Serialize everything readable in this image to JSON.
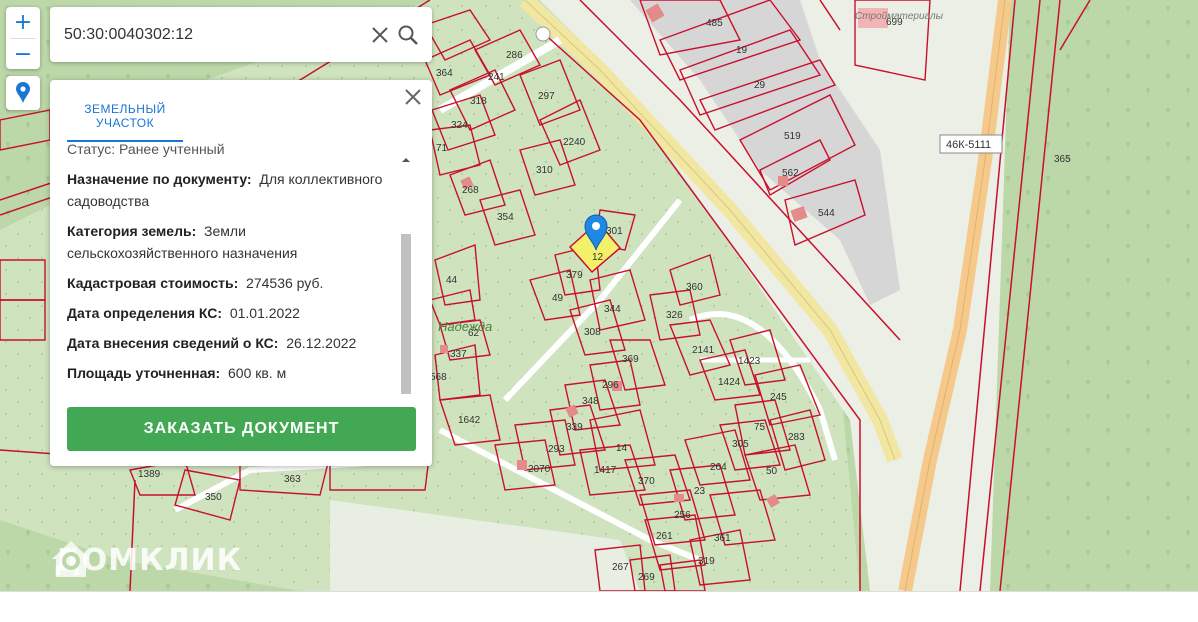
{
  "search": {
    "value": "50:30:0040302:12"
  },
  "zoom": {
    "in_label": "+",
    "out_label": "−"
  },
  "panel": {
    "tab_label_line1": "ЗЕМЕЛЬНЫЙ",
    "tab_label_line2": "УЧАСТОК",
    "status_partial": "Статус: Ранее учтенный",
    "fields": [
      {
        "label": "Назначение по документу:",
        "value": "Для коллективного садоводства"
      },
      {
        "label": "Категория земель:",
        "value": "Земли сельскохозяйственного назначения"
      },
      {
        "label": "Кадастровая стоимость:",
        "value": "274536 руб."
      },
      {
        "label": "Дата определения КС:",
        "value": "01.01.2022"
      },
      {
        "label": "Дата внесения сведений о КС:",
        "value": "26.12.2022"
      },
      {
        "label": "Площадь уточненная:",
        "value": "600 кв. м"
      }
    ],
    "order_button": "ЗАКАЗАТЬ ДОКУМЕНТ"
  },
  "map": {
    "road_label": "46К-5111",
    "area_label": "Надежда",
    "shop_label": "Стройматериалы",
    "selected_parcel_label": "12",
    "parcel_labels": [
      "485",
      "19",
      "29",
      "519",
      "562",
      "544",
      "699",
      "365",
      "286",
      "241",
      "364",
      "318",
      "324",
      "71",
      "297",
      "2240",
      "310",
      "268",
      "354",
      "301",
      "379",
      "49",
      "44",
      "360",
      "344",
      "326",
      "308",
      "62",
      "337",
      "568",
      "2141",
      "1423",
      "369",
      "296",
      "1424",
      "348",
      "339",
      "1642",
      "245",
      "75",
      "283",
      "305",
      "14",
      "293",
      "1417",
      "2070",
      "264",
      "50",
      "370",
      "23",
      "256",
      "361",
      "261",
      "319",
      "267",
      "269",
      "1389",
      "350",
      "363"
    ],
    "colors": {
      "parcel_border": "#c8102e",
      "selected_fill": "#f3f06a",
      "forest": "#bcd8a8",
      "road": "#f5c98a",
      "buildings": "#d6d6d6"
    }
  },
  "logo": {
    "text": "ДОМКЛИК"
  }
}
